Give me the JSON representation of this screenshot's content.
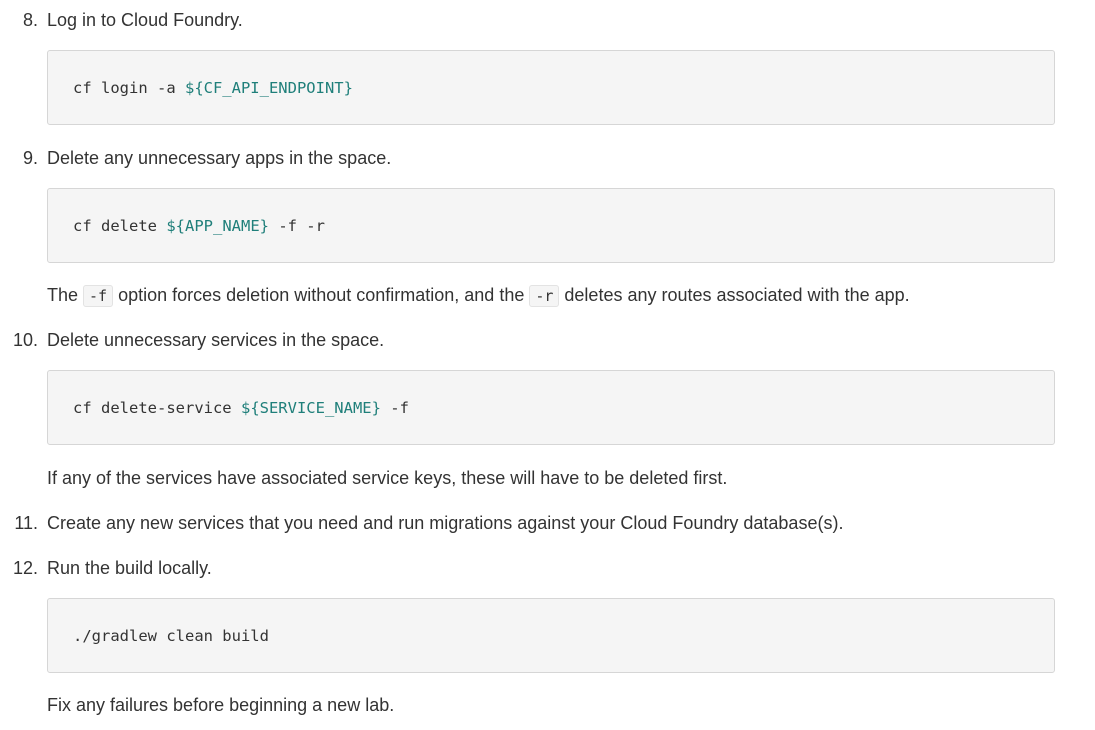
{
  "steps": [
    {
      "number": "8.",
      "text": "Log in to Cloud Foundry.",
      "code": {
        "prefix": "cf login -a ",
        "var": "${CF_API_ENDPOINT}",
        "suffix": ""
      }
    },
    {
      "number": "9.",
      "text": "Delete any unnecessary apps in the space.",
      "code": {
        "prefix": "cf delete ",
        "var": "${APP_NAME}",
        "suffix": " -f -r"
      },
      "note": {
        "part1": "The ",
        "code1": "-f",
        "part2": " option forces deletion without confirmation, and the ",
        "code2": "-r",
        "part3": " deletes any routes associated with the app."
      }
    },
    {
      "number": "10.",
      "text": "Delete unnecessary services in the space.",
      "code": {
        "prefix": "cf delete-service ",
        "var": "${SERVICE_NAME}",
        "suffix": " -f"
      },
      "note": "If any of the services have associated service keys, these will have to be deleted first."
    },
    {
      "number": "11.",
      "text": "Create any new services that you need and run migrations against your Cloud Foundry database(s)."
    },
    {
      "number": "12.",
      "text": "Run the build locally.",
      "code": {
        "prefix": "./gradlew clean build",
        "var": "",
        "suffix": ""
      },
      "note": "Fix any failures before beginning a new lab."
    }
  ]
}
